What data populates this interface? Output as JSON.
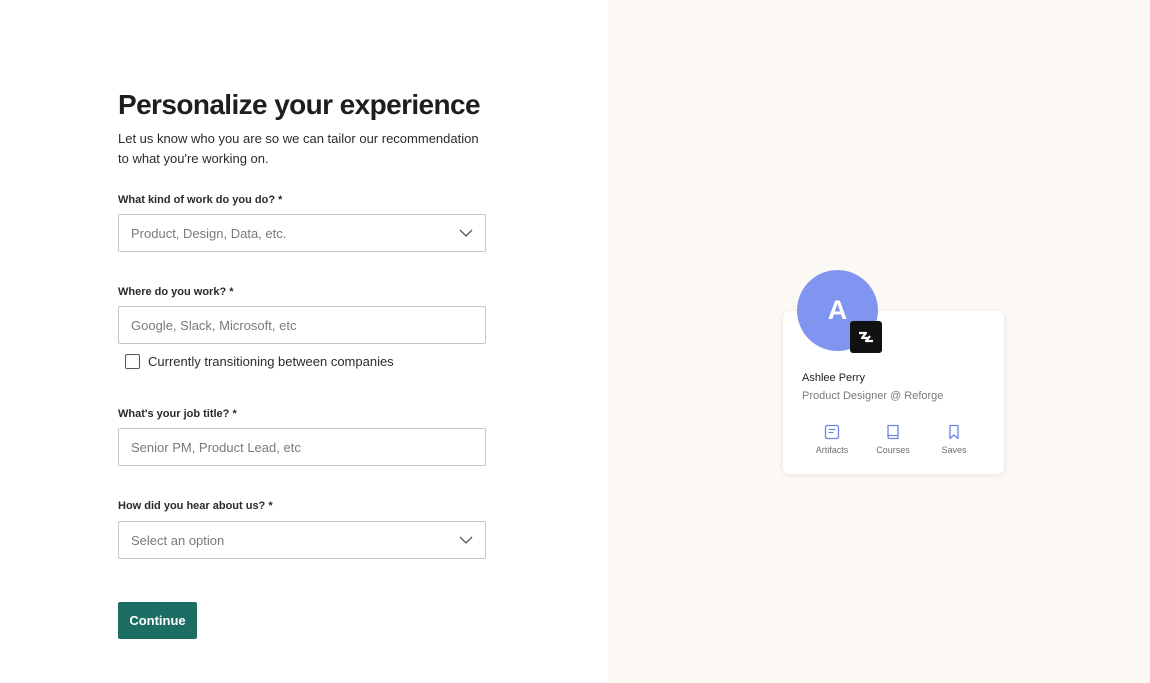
{
  "form": {
    "title": "Personalize your experience",
    "subtitle": "Let us know who you are so we can tailor our recommendation to what you're working on.",
    "work_kind": {
      "label": "What kind of work do you do? *",
      "placeholder": "Product, Design, Data, etc."
    },
    "workplace": {
      "label": "Where do you work? *",
      "placeholder": "Google, Slack, Microsoft, etc"
    },
    "transitioning": {
      "label": "Currently transitioning between companies",
      "checked": false
    },
    "job_title": {
      "label": "What's your job title? *",
      "placeholder": "Senior PM, Product Lead, etc"
    },
    "hear_about": {
      "label": "How did you hear about us? *",
      "placeholder": "Select an option"
    },
    "continue_label": "Continue"
  },
  "profile_card": {
    "avatar_initial": "A",
    "name": "Ashlee Perry",
    "role": "Product Designer @ Reforge",
    "actions": [
      {
        "label": "Artifacts",
        "icon": "artifacts-icon"
      },
      {
        "label": "Courses",
        "icon": "courses-icon"
      },
      {
        "label": "Saves",
        "icon": "bookmark-icon"
      }
    ]
  },
  "colors": {
    "accent": "#1c6e64",
    "avatar": "#7f95ef",
    "right_panel_bg": "#fcf8f4",
    "icon_blue": "#6d83e6"
  }
}
